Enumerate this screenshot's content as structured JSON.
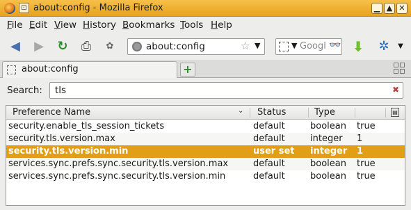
{
  "window": {
    "title": "about:config - Mozilla Firefox"
  },
  "menu": [
    "File",
    "Edit",
    "View",
    "History",
    "Bookmarks",
    "Tools",
    "Help"
  ],
  "nav": {
    "url": "about:config",
    "search_placeholder": "Googl"
  },
  "tabs": [
    {
      "label": "about:config"
    }
  ],
  "filter": {
    "label": "Search:",
    "value": "tls"
  },
  "columns": {
    "name": "Preference Name",
    "status": "Status",
    "type": "Type"
  },
  "rows": [
    {
      "name": "security.enable_tls_session_tickets",
      "status": "default",
      "type": "boolean",
      "value": "true"
    },
    {
      "name": "security.tls.version.max",
      "status": "default",
      "type": "integer",
      "value": "1"
    },
    {
      "name": "security.tls.version.min",
      "status": "user set",
      "type": "integer",
      "value": "1"
    },
    {
      "name": "services.sync.prefs.sync.security.tls.version.max",
      "status": "default",
      "type": "boolean",
      "value": "true"
    },
    {
      "name": "services.sync.prefs.sync.security.tls.version.min",
      "status": "default",
      "type": "boolean",
      "value": "true"
    }
  ],
  "selected_row": 2,
  "colors": {
    "titlebar": "#f0b232",
    "selection": "#e09f14",
    "green": "#2d8a2d"
  }
}
